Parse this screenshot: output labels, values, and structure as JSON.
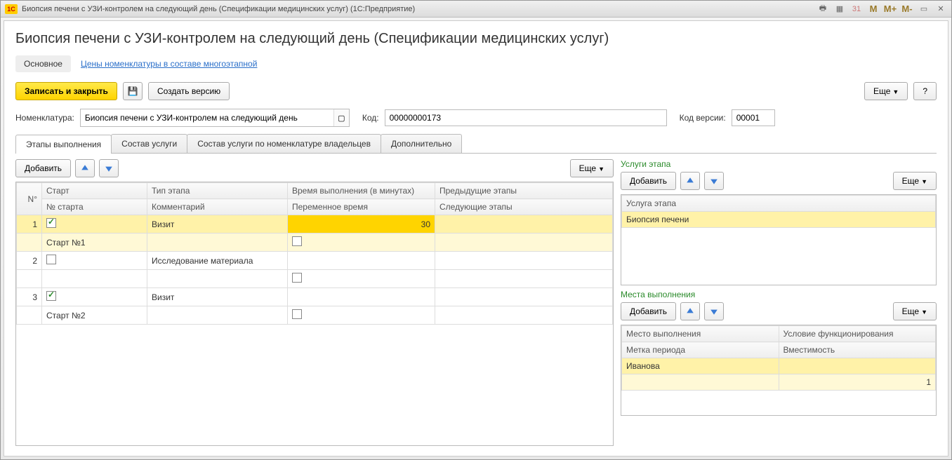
{
  "titlebar": {
    "title": "Биопсия печени с УЗИ-контролем на следующий день (Спецификации медицинских услуг)  (1С:Предприятие)",
    "m": "M",
    "mplus": "M+",
    "mminus": "M-"
  },
  "header": {
    "title": "Биопсия печени с УЗИ-контролем на следующий день (Спецификации медицинских услуг)"
  },
  "nav": {
    "main": "Основное",
    "link": "Цены номенклатуры в составе многоэтапной"
  },
  "toolbar": {
    "save_close": "Записать и закрыть",
    "create_version": "Создать версию",
    "more": "Еще",
    "help": "?"
  },
  "form": {
    "nom_label": "Номенклатура:",
    "nom_value": "Биопсия печени с УЗИ-контролем на следующий день",
    "code_label": "Код:",
    "code_value": "00000000173",
    "vcode_label": "Код версии:",
    "vcode_value": "00001"
  },
  "tabs": {
    "t1": "Этапы выполнения",
    "t2": "Состав услуги",
    "t3": "Состав услуги по номенклатуре владельцев",
    "t4": "Дополнительно"
  },
  "subtoolbar": {
    "add": "Добавить",
    "more": "Еще"
  },
  "stages_table": {
    "h_num": "N°",
    "h_start": "Старт",
    "h_type": "Тип этапа",
    "h_time": "Время выполнения (в минутах)",
    "h_prev": "Предыдущие этапы",
    "h_startnum": "№ старта",
    "h_comment": "Комментарий",
    "h_vartime": "Переменное время",
    "h_next": "Следующие этапы",
    "rows": [
      {
        "n": "1",
        "start": true,
        "type": "Визит",
        "time": "30",
        "startnum": "Старт №1"
      },
      {
        "n": "2",
        "start": false,
        "type": "Исследование материала",
        "time": "",
        "startnum": ""
      },
      {
        "n": "3",
        "start": true,
        "type": "Визит",
        "time": "",
        "startnum": "Старт №2"
      }
    ]
  },
  "stage_services": {
    "title": "Услуги этапа",
    "header": "Услуга этапа",
    "row1": "Биопсия печени"
  },
  "places": {
    "title": "Места выполнения",
    "h_place": "Место выполнения",
    "h_cond": "Условие функционирования",
    "h_mark": "Метка периода",
    "h_cap": "Вместимость",
    "row_place": "Иванова",
    "row_cap": "1"
  }
}
